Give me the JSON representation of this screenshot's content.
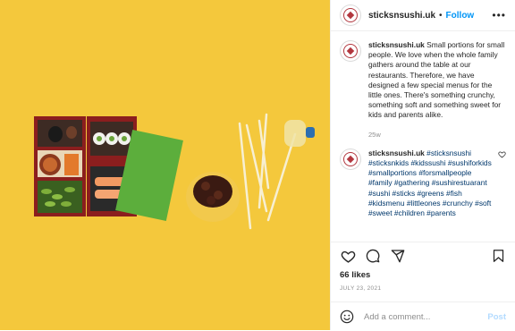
{
  "post": {
    "username": "sticksnsushi.uk",
    "separator": "•",
    "follow_label": "Follow",
    "more_icon": "•••"
  },
  "caption": {
    "username": "sticksnsushi.uk",
    "text": "Small portions for small people. We love when the whole family gathers around the table at our restaurants. Therefore, we have designed a few special menus for the little ones. There's something crunchy, something soft and something sweet for kids and parents alike.",
    "age": "25w"
  },
  "comment": {
    "username": "sticksnsushi.uk",
    "text": "#sticksnsushi #sticksnkids #kidssushi #sushiforkids #smallportions #forsmallpeople #family #gathering #sushirestuarant #sushi #sticks #greens #fish #kidsmenu #littleones #crunchy #soft #sweet #children #parents"
  },
  "stats": {
    "likes": "66 likes",
    "date": "JULY 23, 2021"
  },
  "composer": {
    "placeholder": "Add a comment...",
    "post_label": "Post"
  },
  "icons": [
    "heart-icon",
    "comment-icon",
    "share-icon",
    "bookmark-icon",
    "smile-icon",
    "avatar-logo"
  ],
  "colors": {
    "photo_background": "#f4c83c",
    "follow": "#0095f6",
    "post_disabled": "#b3dbff",
    "hashtag": "#00376b",
    "brand": "#b2373f"
  }
}
